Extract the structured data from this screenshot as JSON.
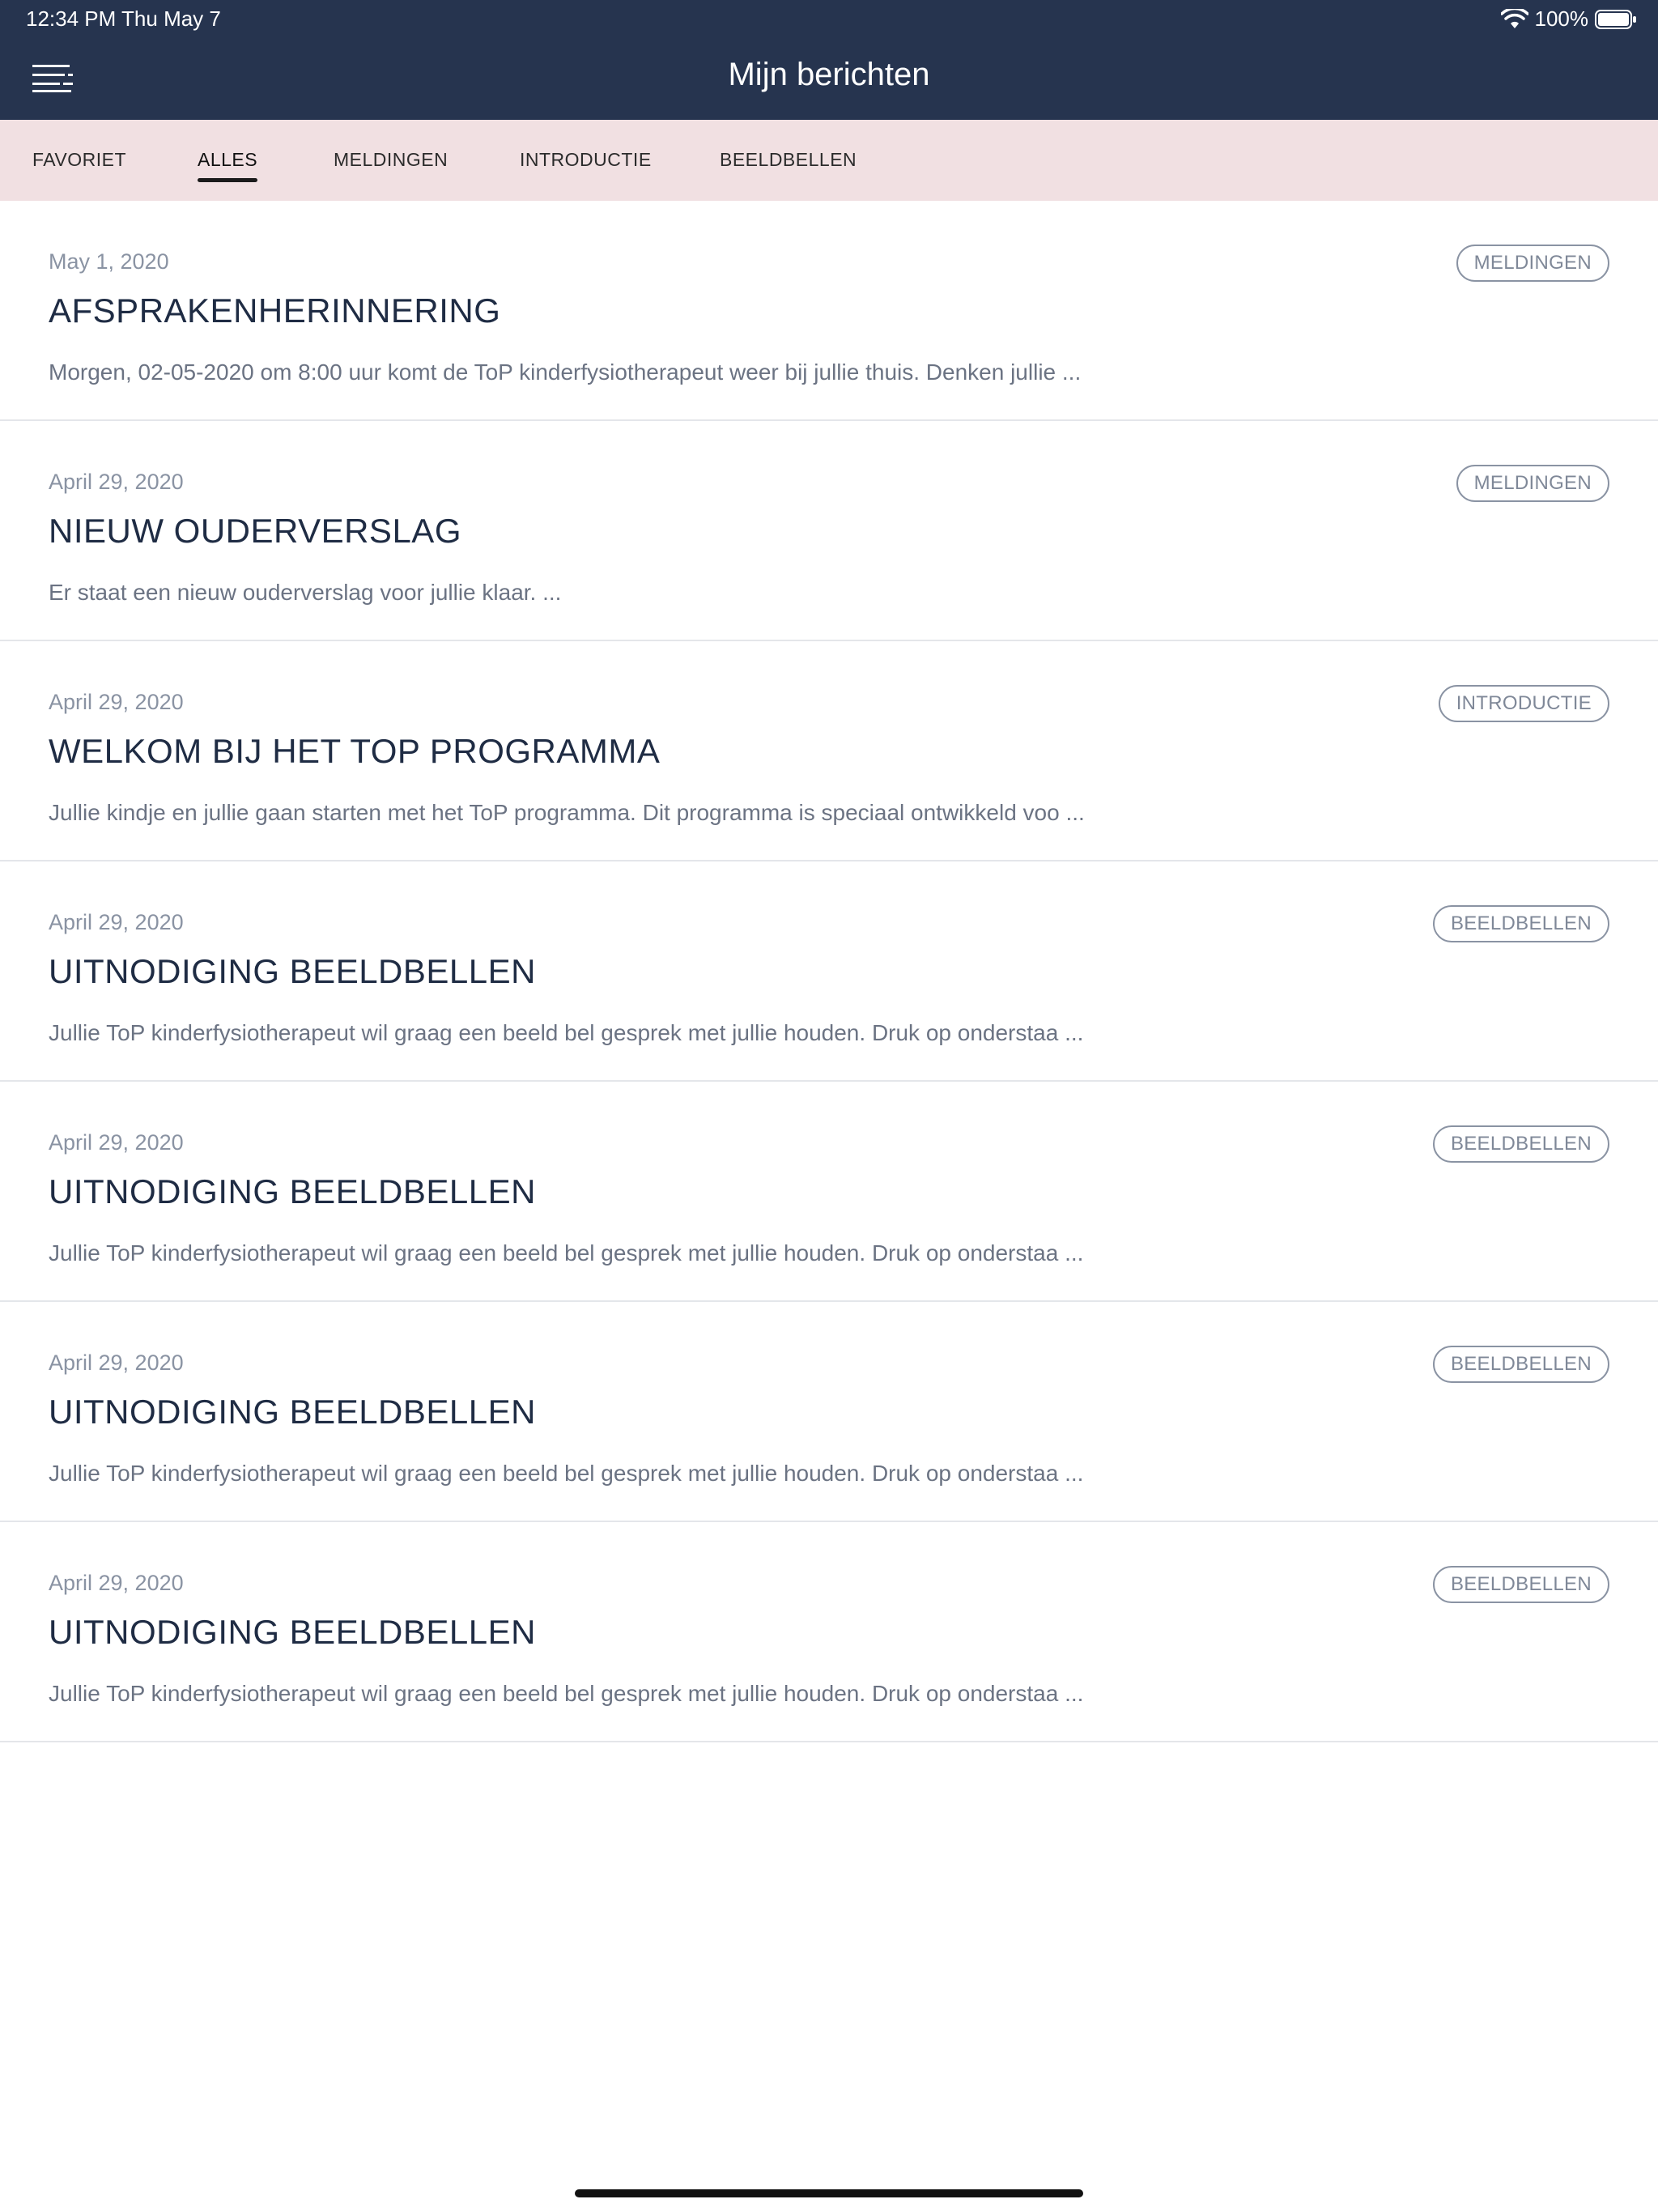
{
  "status_bar": {
    "time": "12:34 PM   Thu May 7",
    "battery": "100%"
  },
  "header": {
    "title": "Mijn berichten",
    "menu_icon": "menu-icon"
  },
  "tabs": [
    {
      "label": "FAVORIET",
      "active": false
    },
    {
      "label": "ALLES",
      "active": true
    },
    {
      "label": "MELDINGEN",
      "active": false
    },
    {
      "label": "INTRODUCTIE",
      "active": false
    },
    {
      "label": "BEELDBELLEN",
      "active": false
    }
  ],
  "messages": [
    {
      "date": "May 1, 2020",
      "title": "AFSPRAKENHERINNERING",
      "excerpt": "Morgen, 02-05-2020 om 8:00 uur komt de ToP kinderfysiotherapeut weer bij jullie thuis. Denken jullie ...",
      "badge": "MELDINGEN"
    },
    {
      "date": "April 29, 2020",
      "title": "NIEUW OUDERVERSLAG",
      "excerpt": "Er staat een nieuw ouderverslag voor jullie klaar. ...",
      "badge": "MELDINGEN"
    },
    {
      "date": "April 29, 2020",
      "title": "WELKOM BIJ HET TOP PROGRAMMA",
      "excerpt": "Jullie kindje en jullie gaan starten met het ToP programma. Dit programma is speciaal ontwikkeld voo ...",
      "badge": "INTRODUCTIE"
    },
    {
      "date": "April 29, 2020",
      "title": "UITNODIGING BEELDBELLEN",
      "excerpt": "Jullie ToP kinderfysiotherapeut wil graag een beeld bel gesprek met jullie houden. Druk op onderstaa ...",
      "badge": "BEELDBELLEN"
    },
    {
      "date": "April 29, 2020",
      "title": "UITNODIGING BEELDBELLEN",
      "excerpt": "Jullie ToP kinderfysiotherapeut wil graag een beeld bel gesprek met jullie houden. Druk op onderstaa ...",
      "badge": "BEELDBELLEN"
    },
    {
      "date": "April 29, 2020",
      "title": "UITNODIGING BEELDBELLEN",
      "excerpt": "Jullie ToP kinderfysiotherapeut wil graag een beeld bel gesprek met jullie houden. Druk op onderstaa ...",
      "badge": "BEELDBELLEN"
    },
    {
      "date": "April 29, 2020",
      "title": "UITNODIGING BEELDBELLEN",
      "excerpt": "Jullie ToP kinderfysiotherapeut wil graag een beeld bel gesprek met jullie houden. Druk op onderstaa ...",
      "badge": "BEELDBELLEN"
    }
  ],
  "colors": {
    "header_bg": "#26344f",
    "tabs_bg": "#f1e0e2",
    "title_text": "#1f2c44",
    "muted_text": "#8a93a3"
  }
}
